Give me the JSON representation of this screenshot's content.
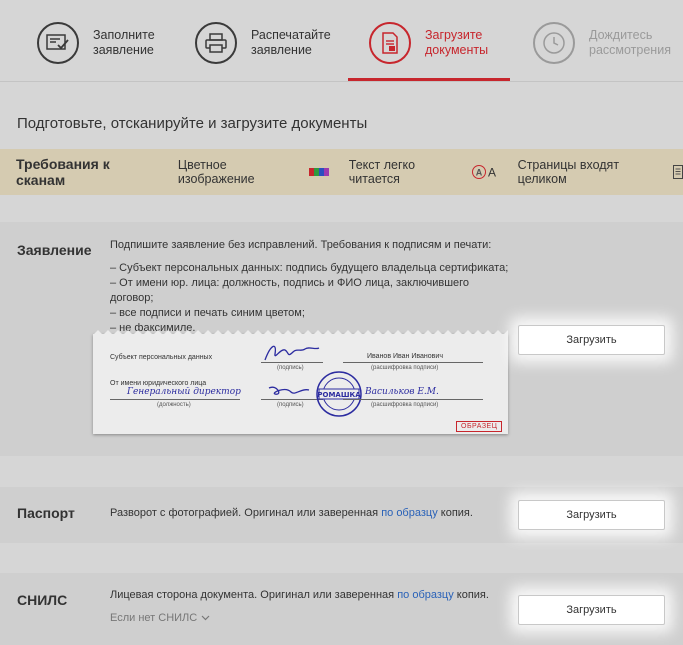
{
  "stepper": {
    "steps": [
      {
        "label": "Заполните\nзаявление",
        "state": "done",
        "icon": "form-check-icon"
      },
      {
        "label": "Распечатайте\nзаявление",
        "state": "done",
        "icon": "printer-icon"
      },
      {
        "label": "Загрузите\nдокументы",
        "state": "active",
        "icon": "upload-document-icon"
      },
      {
        "label": "Дождитесь\nрассмотрения",
        "state": "pending",
        "icon": "clock-icon"
      }
    ]
  },
  "heading": "Подготовьте, отсканируйте и загрузите документы",
  "requirements": {
    "title": "Требования к сканам",
    "items": [
      {
        "label": "Цветное изображение",
        "icon": "color-swatch-icon"
      },
      {
        "label": "Текст легко читается",
        "icon": "font-size-icon"
      },
      {
        "label": "Страницы входят целиком",
        "icon": "page-icon"
      }
    ]
  },
  "sections": {
    "statement": {
      "title": "Заявление",
      "intro": "Подпишите заявление без исправлений. Требования к подписям и печати:",
      "rules": [
        "– Субъект персональных данных: подпись будущего владельца сертификата;",
        "– От имени юр. лица: должность, подпись и ФИО лица, заключившего договор;",
        "– все подписи и печать синим цветом;",
        "– не факсимиле."
      ],
      "upload_label": "Загрузить",
      "sample": {
        "subject_label": "Субъект персональных данных",
        "signature_caption": "(подпись)",
        "name_value": "Иванов Иван Иванович",
        "name_caption": "(расшифровка подписи)",
        "org_label": "От имени юридического лица",
        "position_value": "Генеральный директор",
        "position_caption": "(должность)",
        "stamp_text": "РОМАШКА",
        "org_name_value": "Васильков Е.М.",
        "badge": "ОБРАЗЕЦ"
      }
    },
    "passport": {
      "title": "Паспорт",
      "text_before": "Разворот с фотографией. Оригинал или заверенная ",
      "link": "по образцу",
      "text_after": " копия.",
      "upload_label": "Загрузить"
    },
    "snils": {
      "title": "СНИЛС",
      "text_before": "Лицевая сторона документа. Оригинал или заверенная ",
      "link": "по образцу",
      "text_after": " копия.",
      "toggle": "Если нет СНИЛС",
      "upload_label": "Загрузить"
    }
  },
  "colors": {
    "accent": "#c7262d",
    "link": "#2a62b8",
    "requirements_bg": "#d5cbb1",
    "signature_ink": "#2c2ca0"
  }
}
